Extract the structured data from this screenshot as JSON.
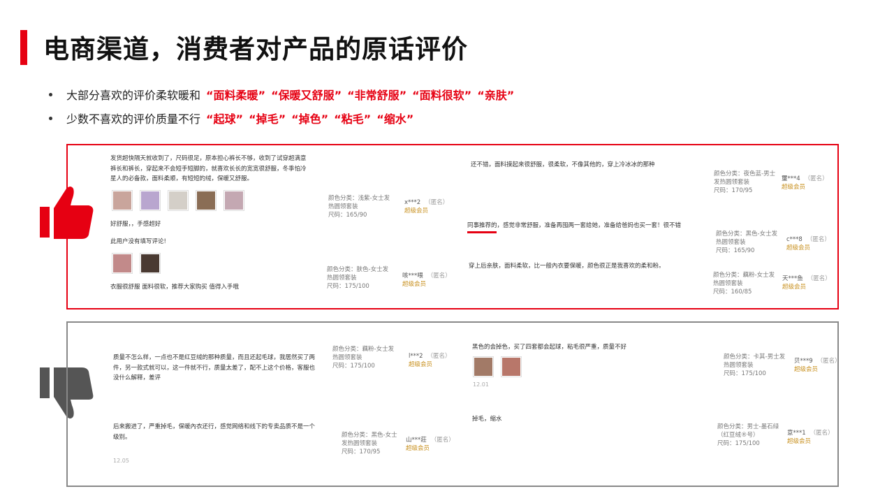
{
  "title": "电商渠道，消费者对产品的原话评价",
  "bullets": [
    {
      "text": "大部分喜欢的评价柔软暖和",
      "keywords": [
        "“面料柔暖”",
        "“保暖又舒服”",
        "“非常舒服”",
        "“面料很软”",
        "“亲肤”"
      ]
    },
    {
      "text": "少数不喜欢的评价质量不行",
      "keywords": [
        "“起球”",
        "“掉毛”",
        "“掉色”",
        "“粘毛”",
        "“缩水”"
      ]
    }
  ],
  "colors": {
    "accent": "#e60012",
    "vip": "#c8901e",
    "neutral_border": "#888888"
  },
  "icons": {
    "positive": "thumbs-up-icon",
    "negative": "thumbs-down-icon"
  },
  "positive": {
    "left": [
      {
        "text": "发货超快隔天就收到了，尺码很足，原本担心裤长不够，收到了试穿超满意裤长和裤长，穿起来不会短手短脚的，就喜欢长长的宽宽很舒服，冬季怕冷星人的必备款，面料柔顺，有短短的绒，保暖又舒服。",
        "sku_color": "颜色分类：浅紫-女士发热圆领套装",
        "sku_size": "尺码：165/90",
        "user": "x***2",
        "anon": "（匿名）",
        "vip": "超级会员"
      },
      {
        "text": "好舒服，，手感超好",
        "text2": "此用户没有填写评论!",
        "text3": "衣服很舒服 面料很软，推荐大家购买 值得入手哦",
        "sku_color": "颜色分类：肤色-女士发热圆领套装",
        "sku_size": "尺码：175/100",
        "user": "咳***喂",
        "anon": "（匿名）",
        "vip": "超级会员"
      }
    ],
    "right": [
      {
        "text": "还不错，面料摸起来很舒服，很柔软，不像其他的，穿上冷冰冰的那种",
        "sku_color": "颜色分类：夜色蓝-男士发热圆领套装",
        "sku_size": "尺码：170/95",
        "user": "璽***4",
        "anon": "（匿名）",
        "vip": "超级会员"
      },
      {
        "text": "同事推荐的，感觉非常舒服，准备再囤两一套给她，准备给爸妈也买一套！很不错",
        "sku_color": "颜色分类：黑色-女士发热圆领套装",
        "sku_size": "尺码：165/90",
        "user": "c***8",
        "anon": "（匿名）",
        "vip": "超级会员"
      },
      {
        "text": "穿上后亲肤，面料柔软，比一般內衣要保暖，颜色很正是我喜欢的柔和粉。",
        "sku_color": "颜色分类：藕粉-女士发热圆领套装",
        "sku_size": "尺码：160/85",
        "user": "天***鱼",
        "anon": "（匿名）",
        "vip": "超级会员"
      }
    ]
  },
  "negative": {
    "left": [
      {
        "text": "质量不怎么样，一点也不是红豆绒的那种质量，而且还起毛球，我居然买了两件，另一款式就可以，这一件就不行，质量太差了，配不上这个价格，客服也没什么解释，差评",
        "sku_color": "颜色分类：藕粉-女士发热圆领套装",
        "sku_size": "尺码：175/100",
        "user": "l***2",
        "anon": "（匿名）",
        "vip": "超级会员"
      },
      {
        "text": "后来搬进了，严重掉毛，保暖內衣还行，感觉网络和线下的专卖品质不是一个级别。",
        "date": "12.05",
        "sku_color": "颜色分类：黑色-女士发热圆领套装",
        "sku_size": "尺码：170/95",
        "user": "山***莊",
        "anon": "（匿名）",
        "vip": "超级会员"
      }
    ],
    "right": [
      {
        "text": "黑色的会掉色，买了四套都会起球，粘毛很严重，质量不好",
        "date": "12.01",
        "sku_color": "颜色分类：卡其-男士发热圆领套装",
        "sku_size": "尺码：175/100",
        "user": "贝***9",
        "anon": "（匿名）",
        "vip": "超级会员"
      },
      {
        "text": "掉毛，缩水",
        "sku_color": "颜色分类：男士-墨石绿（红豆绒®号）",
        "sku_size": "尺码：175/100",
        "user": "意***1",
        "anon": "（匿名）",
        "vip": "超级会员"
      }
    ]
  }
}
